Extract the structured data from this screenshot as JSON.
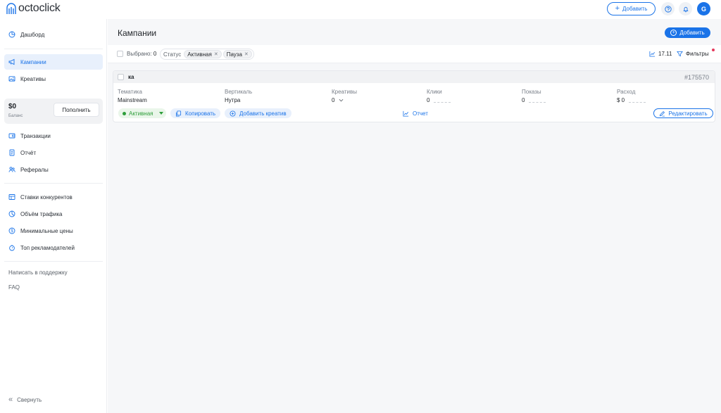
{
  "app": {
    "brand": "octoclick",
    "accent": "#1a73e8"
  },
  "topbar": {
    "add_label": "Добавить",
    "avatar_initial": "G"
  },
  "sidebar": {
    "items_top": [
      {
        "label": "Дашборд",
        "icon": "dashboard-pie-icon"
      }
    ],
    "items_main": [
      {
        "label": "Кампании",
        "icon": "megaphone-icon",
        "active": true
      },
      {
        "label": "Креативы",
        "icon": "image-icon"
      }
    ],
    "balance": {
      "amount": "$0",
      "label": "Баланс",
      "refill_label": "Пополнить"
    },
    "items_finance": [
      {
        "label": "Транзакции",
        "icon": "wallet-icon"
      },
      {
        "label": "Отчёт",
        "icon": "report-icon"
      },
      {
        "label": "Рефералы",
        "icon": "referrals-icon"
      }
    ],
    "items_tools": [
      {
        "label": "Ставки конкурентов",
        "icon": "table-icon"
      },
      {
        "label": "Объём трафика",
        "icon": "pie-chart-icon"
      },
      {
        "label": "Минимальные цены",
        "icon": "dollar-icon"
      },
      {
        "label": "Топ рекламодателей",
        "icon": "stopwatch-icon"
      }
    ],
    "support_label": "Написать в поддержку",
    "faq_label": "FAQ",
    "collapse_label": "Свернуть"
  },
  "main": {
    "title": "Кампании",
    "add_label": "Добавить",
    "filter_bar": {
      "selected_prefix": "Выбрано:",
      "selected_count": "0",
      "status_label": "Статус",
      "chips": [
        "Активная",
        "Пауза"
      ],
      "date": "17.11",
      "filters_label": "Фильтры"
    },
    "campaign": {
      "name": "ка",
      "id": "#175570",
      "columns": [
        {
          "label": "Тематика",
          "value": "Mainstream"
        },
        {
          "label": "Вертикаль",
          "value": "Нутра"
        },
        {
          "label": "Креативы",
          "value": "0"
        },
        {
          "label": "Клики",
          "value": "0"
        },
        {
          "label": "Показы",
          "value": "0"
        },
        {
          "label": "Расход",
          "value": "$ 0"
        }
      ],
      "status": "Активная",
      "copy_label": "Копировать",
      "add_creative_label": "Добавить креатив",
      "report_label": "Отчет",
      "edit_label": "Редактировать"
    }
  }
}
